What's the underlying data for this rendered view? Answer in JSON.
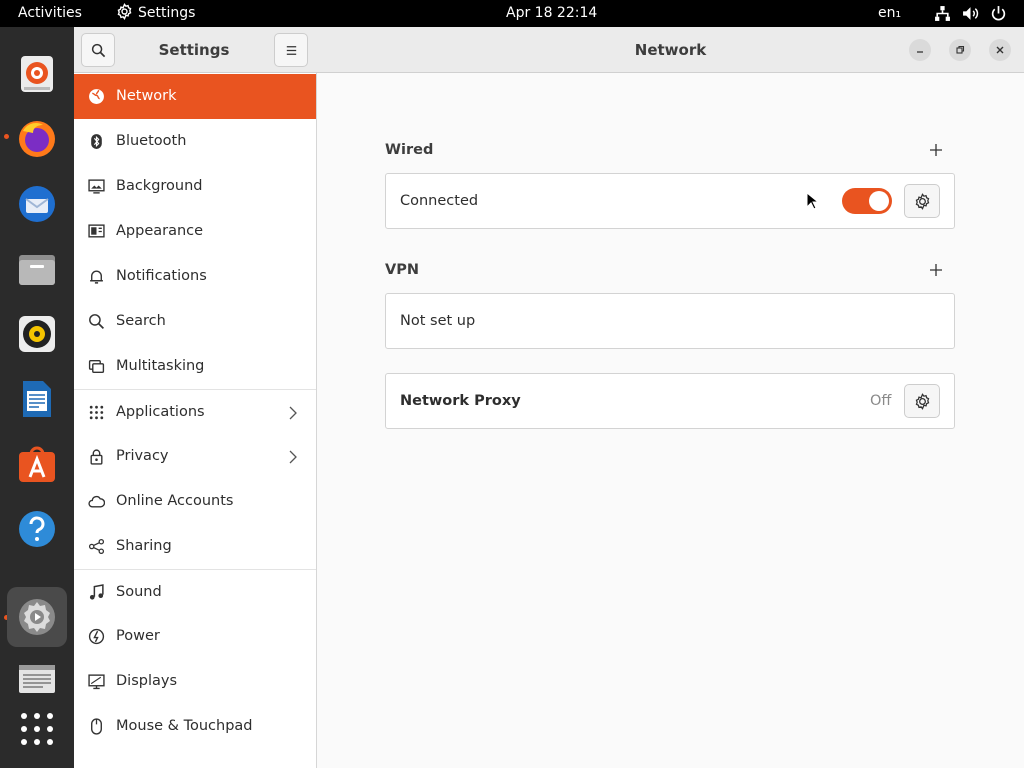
{
  "topbar": {
    "activities": "Activities",
    "app_name": "Settings",
    "clock": "Apr 18  22:14",
    "language": "en₁"
  },
  "dock": {
    "apps": [
      {
        "name": "installer-icon"
      },
      {
        "name": "firefox-icon"
      },
      {
        "name": "thunderbird-icon"
      },
      {
        "name": "files-icon"
      },
      {
        "name": "rhythmbox-icon"
      },
      {
        "name": "writer-icon"
      },
      {
        "name": "app-center-icon"
      },
      {
        "name": "help-icon"
      },
      {
        "name": "settings-icon"
      },
      {
        "name": "text-editor-icon"
      },
      {
        "name": "show-apps-icon"
      }
    ]
  },
  "sidebar": {
    "title": "Settings",
    "items": [
      {
        "label": "Network",
        "icon": "network-icon"
      },
      {
        "label": "Bluetooth",
        "icon": "bluetooth-icon"
      },
      {
        "label": "Background",
        "icon": "background-icon"
      },
      {
        "label": "Appearance",
        "icon": "appearance-icon"
      },
      {
        "label": "Notifications",
        "icon": "bell-icon"
      },
      {
        "label": "Search",
        "icon": "search-icon"
      },
      {
        "label": "Multitasking",
        "icon": "multitasking-icon"
      },
      {
        "label": "Applications",
        "icon": "grid-icon"
      },
      {
        "label": "Privacy",
        "icon": "lock-icon"
      },
      {
        "label": "Online Accounts",
        "icon": "cloud-icon"
      },
      {
        "label": "Sharing",
        "icon": "share-icon"
      },
      {
        "label": "Sound",
        "icon": "music-note-icon"
      },
      {
        "label": "Power",
        "icon": "power-icon"
      },
      {
        "label": "Displays",
        "icon": "display-icon"
      },
      {
        "label": "Mouse & Touchpad",
        "icon": "mouse-icon"
      }
    ]
  },
  "main": {
    "title": "Network",
    "wired": {
      "heading": "Wired",
      "status": "Connected",
      "enabled": true
    },
    "vpn": {
      "heading": "VPN",
      "status": "Not set up"
    },
    "proxy": {
      "label": "Network Proxy",
      "status": "Off"
    }
  },
  "colors": {
    "accent": "#e95420",
    "topbar": "#000000",
    "dock": "#2b2b2b"
  }
}
